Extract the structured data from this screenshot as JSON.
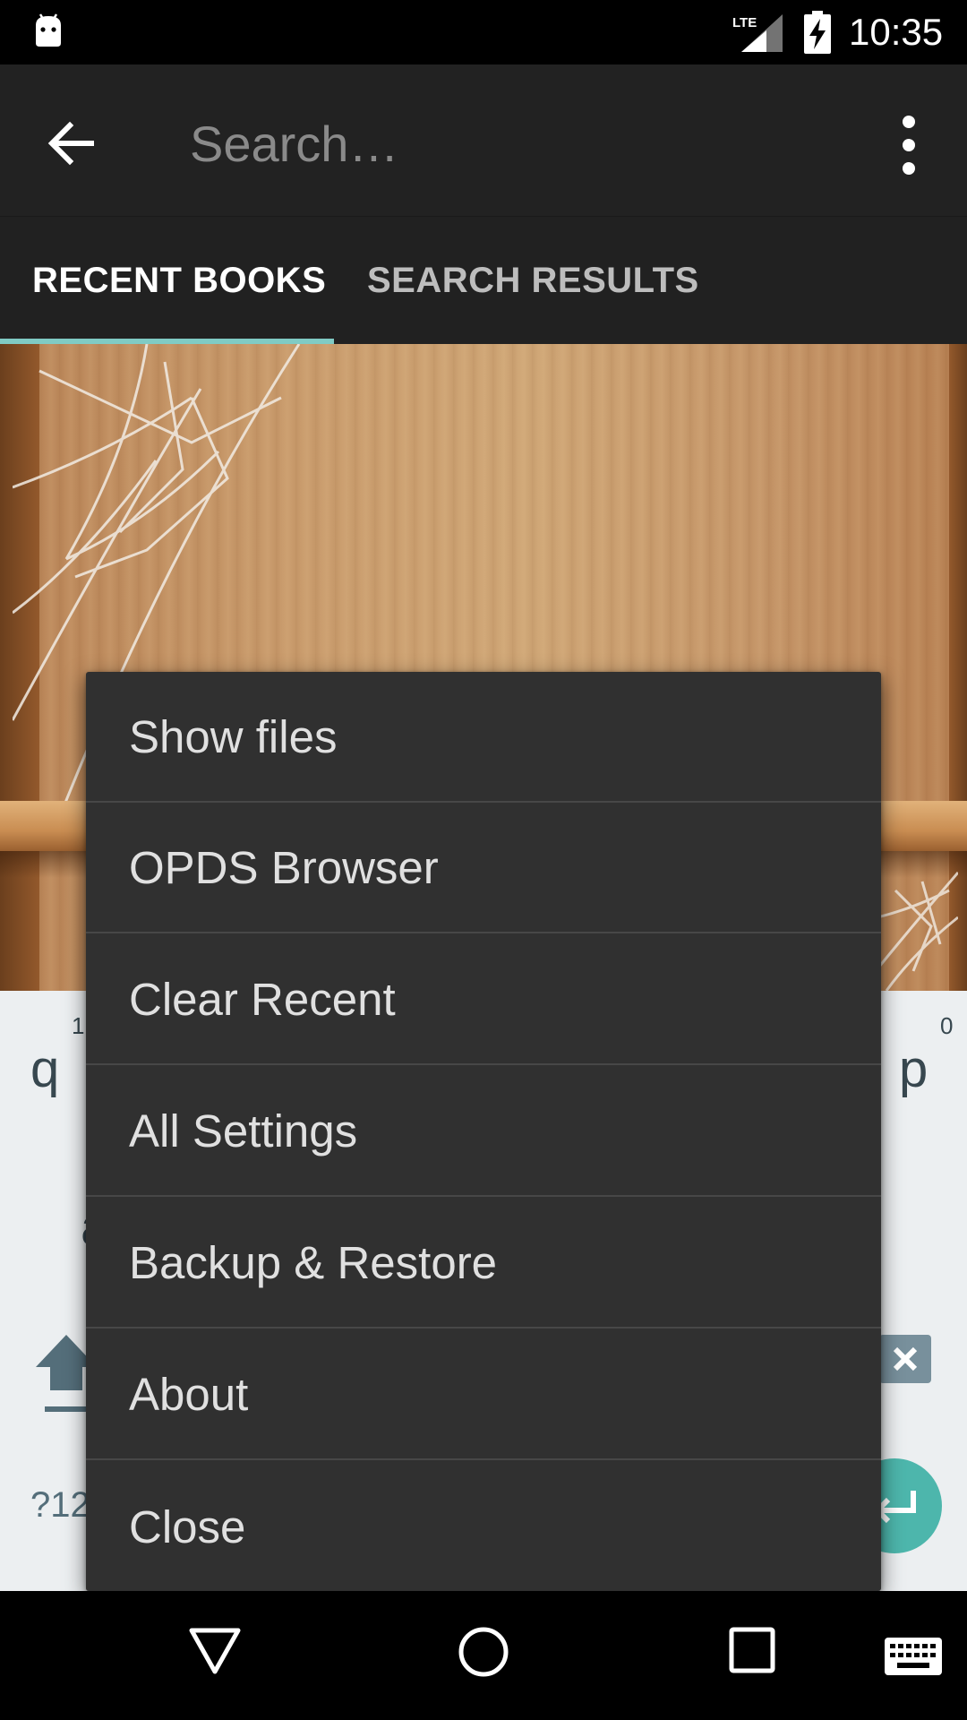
{
  "status_bar": {
    "time": "10:35",
    "network_label": "LTE"
  },
  "toolbar": {
    "search_placeholder": "Search…"
  },
  "tabs": [
    {
      "label": "RECENT BOOKS",
      "selected": true
    },
    {
      "label": "SEARCH RESULTS",
      "selected": false
    }
  ],
  "menu": {
    "items": [
      {
        "label": "Show files"
      },
      {
        "label": "OPDS Browser"
      },
      {
        "label": "Clear Recent"
      },
      {
        "label": "All Settings"
      },
      {
        "label": "Backup & Restore"
      },
      {
        "label": "About"
      },
      {
        "label": "Close"
      }
    ]
  },
  "keyboard": {
    "key_q": "q",
    "key_q_hint": "1",
    "key_p": "p",
    "key_p_hint": "0",
    "key_a": "a",
    "symbols_label": "?12"
  },
  "colors": {
    "accent": "#80cbc4",
    "toolbar": "#222222",
    "menu_background": "#303030",
    "enter_key": "#4db6ac"
  }
}
